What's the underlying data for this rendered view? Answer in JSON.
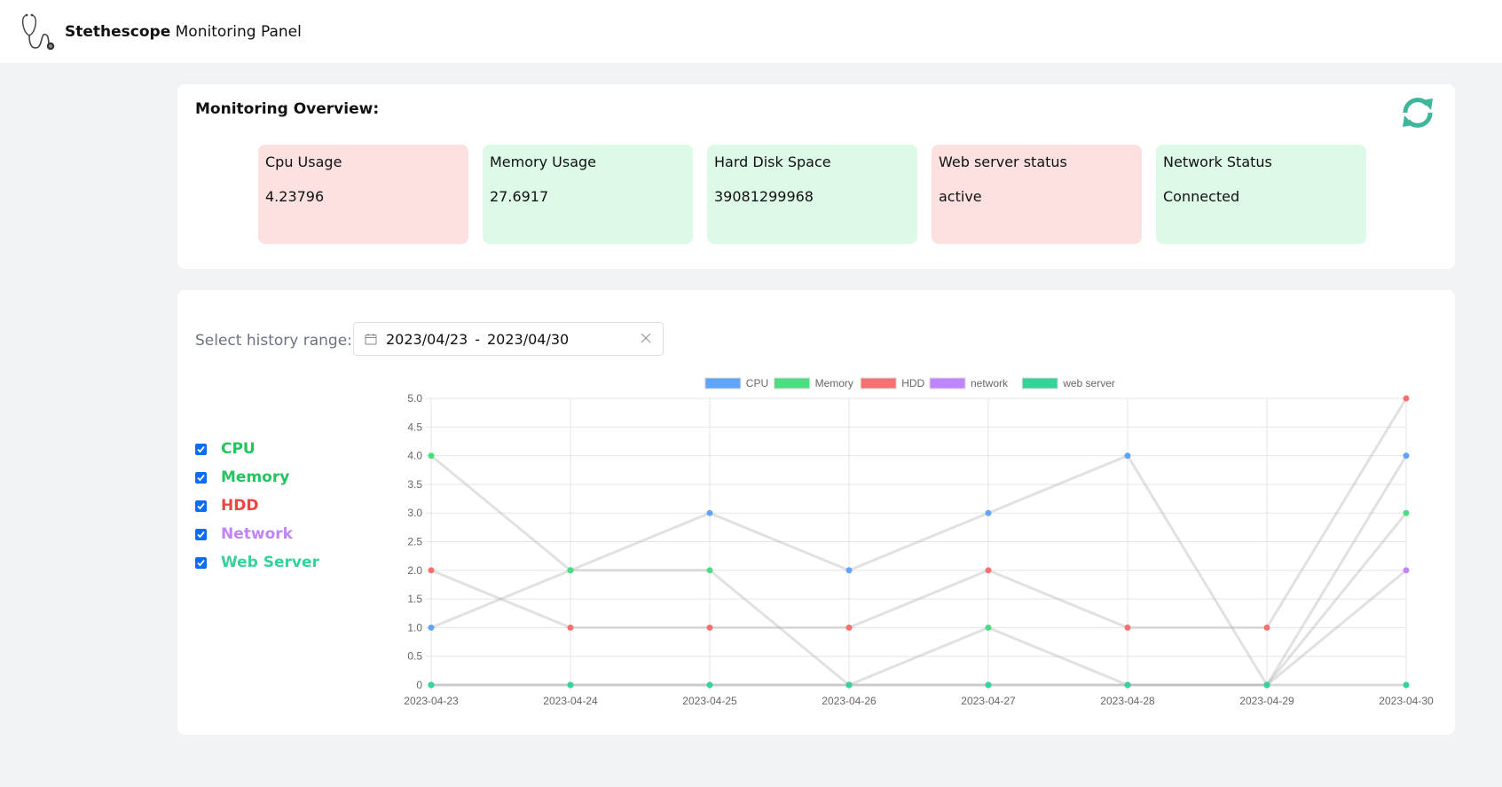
{
  "header": {
    "brand_bold": "Stethescope",
    "brand_rest": " Monitoring Panel",
    "logo_icon": "stethoscope-icon"
  },
  "overview": {
    "title": "Monitoring Overview:",
    "refresh_icon": "refresh-icon",
    "refresh_color": "#3fb59b",
    "cards": [
      {
        "title": "Cpu Usage",
        "value": "4.23796",
        "status": "alert",
        "color": "#fde1e1"
      },
      {
        "title": "Memory Usage",
        "value": "27.6917",
        "status": "ok",
        "color": "#dcfae7"
      },
      {
        "title": "Hard Disk Space",
        "value": "39081299968",
        "status": "ok",
        "color": "#dcfae7"
      },
      {
        "title": "Web server status",
        "value": "active",
        "status": "alert",
        "color": "#fde1e1"
      },
      {
        "title": "Network Status",
        "value": "Connected",
        "status": "ok",
        "color": "#dcfae7"
      }
    ]
  },
  "history": {
    "label": "Select history range:",
    "start": "2023/04/23",
    "separator": "-",
    "end": "2023/04/30",
    "calendar_icon": "calendar-icon",
    "clear_icon": "close-icon"
  },
  "toggles": [
    {
      "label": "CPU",
      "checked": true,
      "color": "#22c55e"
    },
    {
      "label": "Memory",
      "checked": true,
      "color": "#22c55e"
    },
    {
      "label": "HDD",
      "checked": true,
      "color": "#ef4444"
    },
    {
      "label": "Network",
      "checked": true,
      "color": "#c084fc"
    },
    {
      "label": "Web Server",
      "checked": true,
      "color": "#34d399"
    }
  ],
  "chart_data": {
    "type": "line",
    "title": "",
    "xlabel": "",
    "ylabel": "",
    "x": [
      "2023-04-23",
      "2023-04-24",
      "2023-04-25",
      "2023-04-26",
      "2023-04-27",
      "2023-04-28",
      "2023-04-29",
      "2023-04-30"
    ],
    "ylim": [
      0,
      5
    ],
    "yticks": [
      "0",
      "0.5",
      "1.0",
      "1.5",
      "2.0",
      "2.5",
      "3.0",
      "3.5",
      "4.0",
      "4.5",
      "5.0"
    ],
    "grid": true,
    "legend_position": "top",
    "line_color": "#e0e0e0",
    "series": [
      {
        "name": "CPU",
        "color": "#60a5fa",
        "values": [
          1,
          2,
          3,
          2,
          3,
          4,
          0,
          4
        ]
      },
      {
        "name": "Memory",
        "color": "#4ade80",
        "values": [
          4,
          2,
          2,
          0,
          1,
          0,
          0,
          3
        ]
      },
      {
        "name": "HDD",
        "color": "#f87171",
        "values": [
          2,
          1,
          1,
          1,
          2,
          1,
          1,
          5
        ]
      },
      {
        "name": "network",
        "color": "#c084fc",
        "values": [
          0,
          0,
          0,
          0,
          0,
          0,
          0,
          2
        ]
      },
      {
        "name": "web server",
        "color": "#34d399",
        "values": [
          0,
          0,
          0,
          0,
          0,
          0,
          0,
          0
        ]
      }
    ]
  }
}
